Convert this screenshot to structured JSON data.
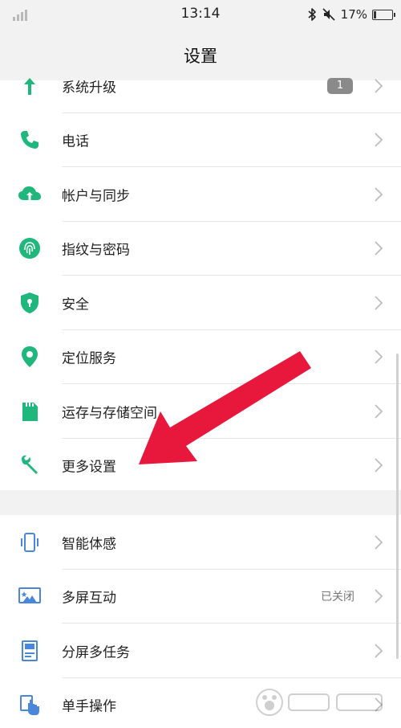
{
  "status_bar": {
    "time": "13:14",
    "battery_percent_text": "17%",
    "battery_level": 0.17
  },
  "header": {
    "title": "设置"
  },
  "settings_group_1": [
    {
      "label": "系统升级",
      "badge": "1",
      "icon": "arrow-up-icon"
    },
    {
      "label": "电话",
      "icon": "phone-icon"
    },
    {
      "label": "帐户与同步",
      "icon": "cloud-sync-icon"
    },
    {
      "label": "指纹与密码",
      "icon": "fingerprint-icon"
    },
    {
      "label": "安全",
      "icon": "shield-icon"
    },
    {
      "label": "定位服务",
      "icon": "location-pin-icon"
    },
    {
      "label": "运存与存储空间",
      "icon": "sd-card-icon"
    },
    {
      "label": "更多设置",
      "icon": "wrench-icon"
    }
  ],
  "settings_group_2": [
    {
      "label": "智能体感",
      "icon": "phone-motion-icon"
    },
    {
      "label": "多屏互动",
      "value": "已关闭",
      "icon": "screen-cast-icon"
    },
    {
      "label": "分屏多任务",
      "icon": "split-screen-icon"
    },
    {
      "label": "单手操作",
      "icon": "one-hand-icon"
    }
  ],
  "colors": {
    "icon_green": "#1fb77c",
    "icon_blue": "#4a86d9",
    "annotation_arrow": "#e8173c",
    "header_bg": "#f2f2f2"
  },
  "watermark": "Baidu经验"
}
